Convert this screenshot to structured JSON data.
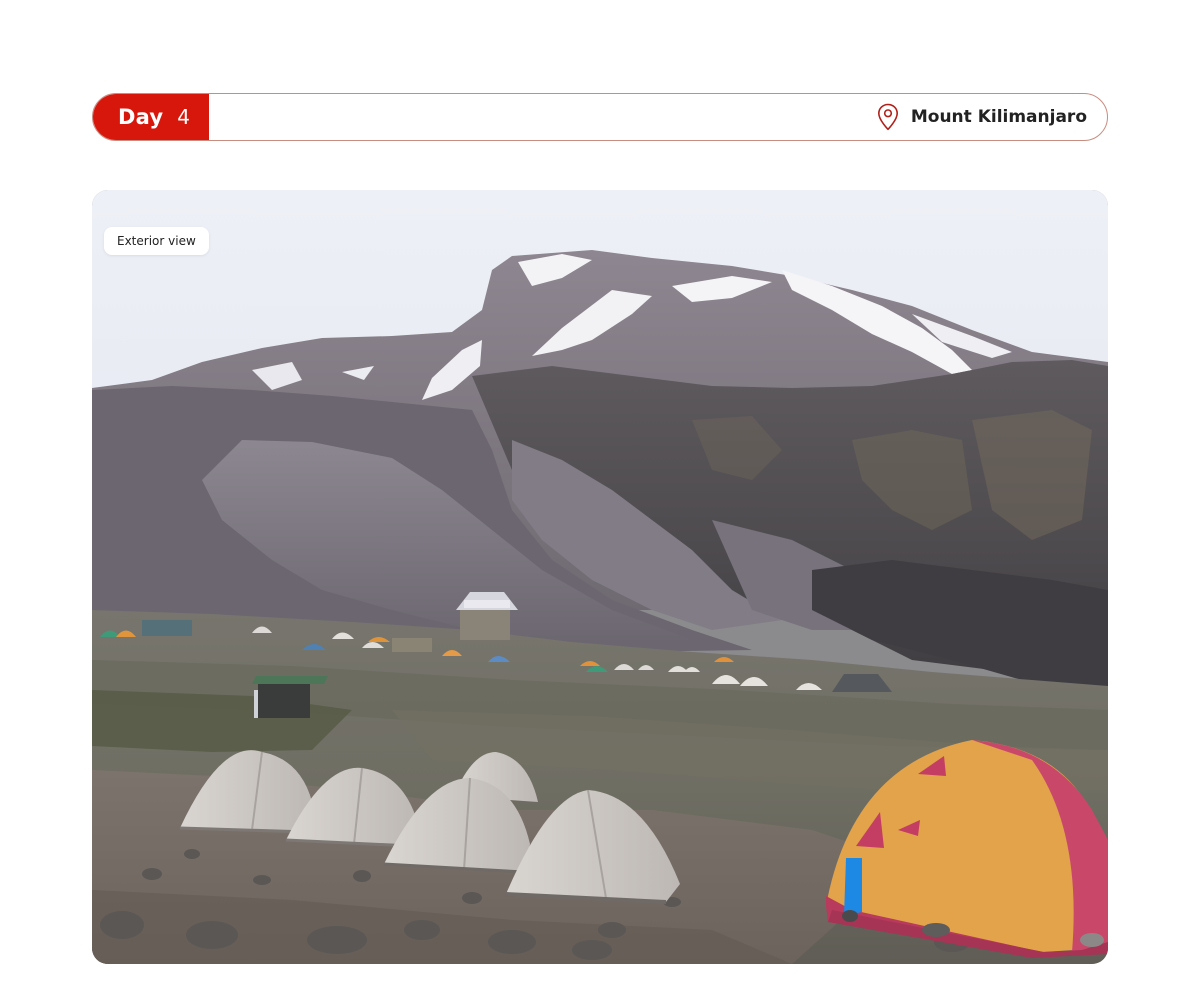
{
  "header": {
    "day_label": "Day",
    "day_number": "4",
    "location_icon": "map-pin-icon",
    "location_name": "Mount Kilimanjaro"
  },
  "photo": {
    "view_label": "Exterior view"
  },
  "colors": {
    "accent_red": "#d8170c",
    "header_border": "#c98c80",
    "text_dark": "#222222"
  }
}
